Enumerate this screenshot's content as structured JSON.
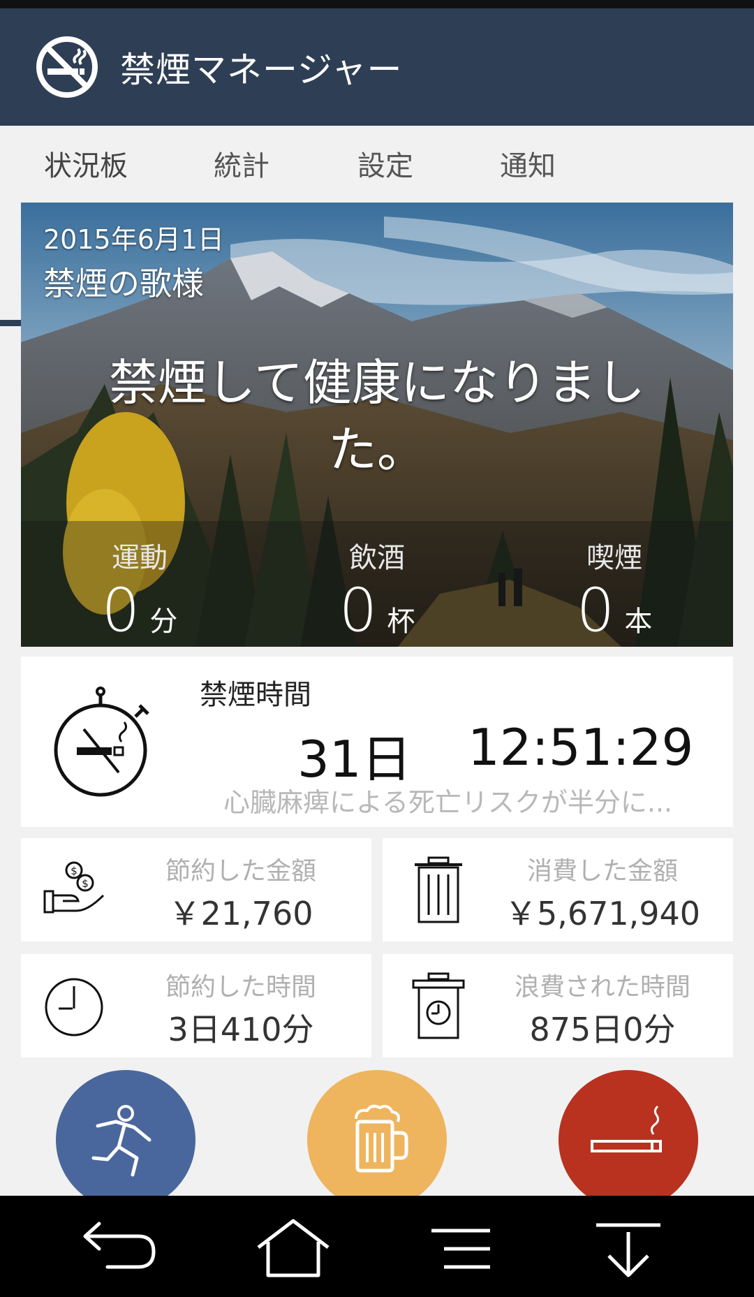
{
  "app": {
    "title": "禁煙マネージャー",
    "icon": "no-smoking-icon",
    "colors": {
      "appbar": "#2e3e55",
      "exercise": "#4a679d",
      "drink": "#eeb55e",
      "smoke": "#b8321f"
    }
  },
  "tabs": [
    {
      "label": "状況板",
      "selected": true
    },
    {
      "label": "統計",
      "selected": false
    },
    {
      "label": "設定",
      "selected": false
    },
    {
      "label": "通知",
      "selected": false
    }
  ],
  "hero": {
    "date": "2015年6月1日",
    "subtitle": "禁煙の歌様",
    "message": "禁煙して健康になりました。",
    "stats": [
      {
        "label": "運動",
        "value": "0",
        "unit": "分"
      },
      {
        "label": "飲酒",
        "value": "0",
        "unit": "杯"
      },
      {
        "label": "喫煙",
        "value": "0",
        "unit": "本"
      }
    ]
  },
  "quit_card": {
    "icon": "stopwatch-no-smoking-icon",
    "title": "禁煙時間",
    "days": "31日",
    "time": "12:51:29",
    "note": "心臓麻痺による死亡リスクが半分に..."
  },
  "summary": [
    {
      "icon": "money-hand-icon",
      "label": "節約した金額",
      "value": "￥21,760"
    },
    {
      "icon": "trash-can-icon",
      "label": "消費した金額",
      "value": "￥5,671,940"
    },
    {
      "icon": "clock-icon",
      "label": "節約した時間",
      "value": "3日410分"
    },
    {
      "icon": "trash-clock-icon",
      "label": "浪費された時間",
      "value": "875日0分"
    }
  ],
  "actions": [
    {
      "name": "exercise",
      "icon": "running-person-icon"
    },
    {
      "name": "drink",
      "icon": "beer-mug-icon"
    },
    {
      "name": "smoke",
      "icon": "cigarette-icon"
    }
  ],
  "navbar": [
    "back-icon",
    "home-icon",
    "menu-icon",
    "collapse-icon"
  ]
}
